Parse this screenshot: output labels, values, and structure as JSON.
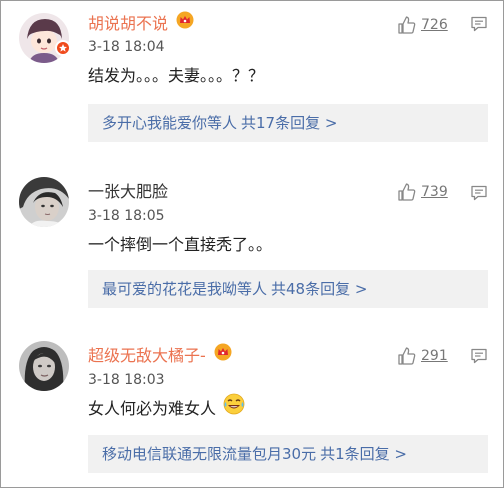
{
  "comments": [
    {
      "name": "胡说胡不说",
      "time": "3-18 18:04",
      "text": "结发为。。。夫妻。。。？？",
      "likes": "726",
      "replies_users": "多开心我能爱你等人",
      "replies_count": "共17条回复 >"
    },
    {
      "name": "一张大肥脸",
      "time": "3-18 18:05",
      "text": "一个摔倒一个直接秃了。。",
      "likes": "739",
      "replies_users": "最可爱的花花是我呦等人",
      "replies_count": "共48条回复 >"
    },
    {
      "name": "超级无敌大橘子-",
      "time": "3-18 18:03",
      "text": "女人何必为难女人",
      "likes": "291",
      "replies_users": "移动电信联通无限流量包月30元",
      "replies_count": "共1条回复 >"
    }
  ],
  "colors": {
    "vip_name": "#eb7350",
    "link": "#4a6da8",
    "reply_bg": "#f1f1f1"
  },
  "icons": {
    "like": "thumbs-up-icon",
    "more": "chat-bubble-icon",
    "member": "crown-icon",
    "verified": "verified-badge-icon",
    "emoji": "laughing-tears-emoji"
  }
}
